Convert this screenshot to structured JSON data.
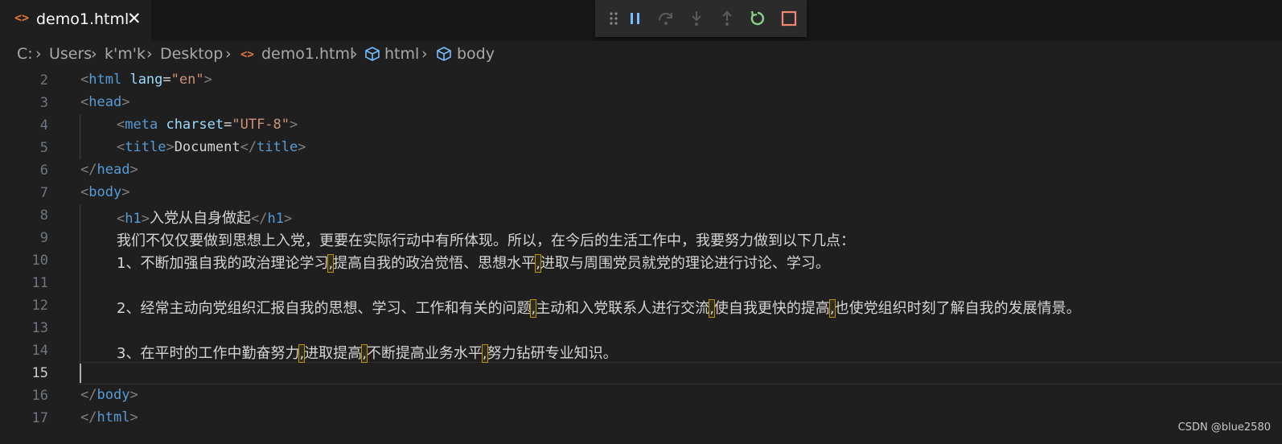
{
  "tab": {
    "icon": "<>",
    "label": "demo1.html",
    "close": "✕"
  },
  "debug_toolbar": {
    "buttons": [
      {
        "name": "drag-handle-icon"
      },
      {
        "name": "pause-icon"
      },
      {
        "name": "step-over-icon"
      },
      {
        "name": "step-into-icon"
      },
      {
        "name": "step-out-icon"
      },
      {
        "name": "restart-icon"
      },
      {
        "name": "stop-icon"
      }
    ]
  },
  "breadcrumbs": {
    "items": [
      "C:",
      "Users",
      "k'm'k",
      "Desktop",
      "demo1.html",
      "html",
      "body"
    ]
  },
  "editor": {
    "line_numbers": [
      "2",
      "3",
      "4",
      "5",
      "6",
      "7",
      "8",
      "9",
      "10",
      "11",
      "12",
      "13",
      "14",
      "15",
      "16",
      "17"
    ],
    "active_line": "15",
    "l2": {
      "open": "<",
      "tag": "html",
      "attr": "lang",
      "eq": "=",
      "val": "\"en\"",
      "close": ">"
    },
    "l3": {
      "open": "<",
      "tag": "head",
      "close": ">"
    },
    "l4": {
      "open": "<",
      "tag": "meta",
      "attr": "charset",
      "eq": "=",
      "val": "\"UTF-8\"",
      "close": ">"
    },
    "l5": {
      "open": "<",
      "tag": "title",
      "close": ">",
      "text": "Document",
      "endopen": "</",
      "endtag": "title",
      "endclose": ">"
    },
    "l6": {
      "open": "</",
      "tag": "head",
      "close": ">"
    },
    "l7": {
      "open": "<",
      "tag": "body",
      "close": ">"
    },
    "l8": {
      "open": "<",
      "tag": "h1",
      "close": ">",
      "text": "入党从自身做起",
      "endopen": "</",
      "endtag": "h1",
      "endclose": ">"
    },
    "l9": {
      "text": "我们不仅仅要做到思想上入党，更要在实际行动中有所体现。所以，在今后的生活工作中，我要努力做到以下几点："
    },
    "l10": {
      "a": "1、不断加强自我的政治理论学习",
      "s1": ",",
      "b": "提高自我的政治觉悟、思想水平",
      "s2": ",",
      "c": "进取与周围党员就党的理论进行讨论、学习。"
    },
    "l12": {
      "a": "2、经常主动向党组织汇报自我的思想、学习、工作和有关的问题",
      "s1": ",",
      "b": "主动和入党联系人进行交流",
      "s2": ",",
      "c": "使自我更快的提高",
      "s3": ",",
      "d": "也使党组织时刻了解自我的发展情景。"
    },
    "l14": {
      "a": "3、在平时的工作中勤奋努力",
      "s1": ",",
      "b": "进取提高",
      "s2": ",",
      "c": "不断提高业务水平",
      "s3": ",",
      "d": "努力钻研专业知识。"
    },
    "l16": {
      "open": "</",
      "tag": "body",
      "close": ">"
    },
    "l17": {
      "open": "</",
      "tag": "html",
      "close": ">"
    }
  },
  "watermark": "CSDN @blue2580",
  "colors": {
    "tag": "#569cd6",
    "attr": "#9cdcfe",
    "string": "#ce9178",
    "bracket": "#808080",
    "highlight": "#b89500"
  }
}
